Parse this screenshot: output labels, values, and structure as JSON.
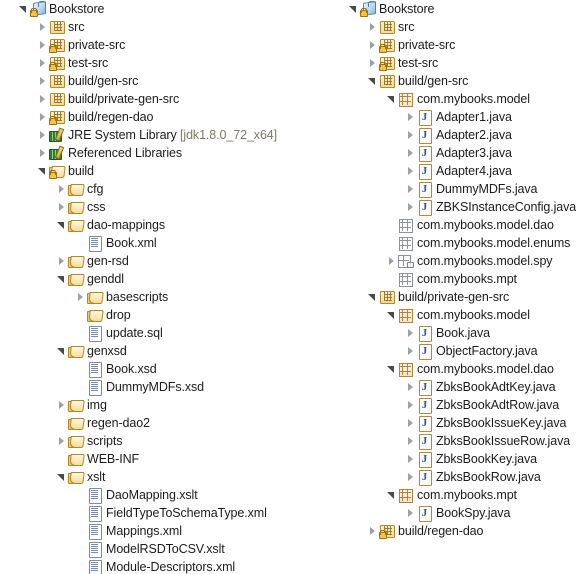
{
  "app": {
    "title": "Eclipse Project Explorer",
    "view_type": "tree",
    "colors": {
      "background": "#ffffff",
      "text": "#1c1c1c",
      "secondary_text": "#7d7a62",
      "twisty_collapsed": "#9aa2ab",
      "twisty_expanded": "#4a4a4a",
      "package_brown": "#b5813f",
      "package_grey": "#8e949b",
      "java_blue": "#2a56a8",
      "folder_gold": "#b3862c"
    }
  },
  "panels": [
    {
      "id": "left",
      "name": "project-tree-left",
      "rows": [
        {
          "indent": 0,
          "twisty": "expanded",
          "icon": "project-icon",
          "label": "Bookstore"
        },
        {
          "indent": 1,
          "twisty": "collapsed",
          "icon": "source-folder-icon",
          "label": "src"
        },
        {
          "indent": 1,
          "twisty": "collapsed",
          "icon": "source-folder-warning-icon",
          "label": "private-src"
        },
        {
          "indent": 1,
          "twisty": "collapsed",
          "icon": "source-folder-warning-icon",
          "label": "test-src"
        },
        {
          "indent": 1,
          "twisty": "collapsed",
          "icon": "source-folder-icon",
          "label": "build/gen-src"
        },
        {
          "indent": 1,
          "twisty": "collapsed",
          "icon": "source-folder-icon",
          "label": "build/private-gen-src"
        },
        {
          "indent": 1,
          "twisty": "collapsed",
          "icon": "source-folder-warning-icon",
          "label": "build/regen-dao"
        },
        {
          "indent": 1,
          "twisty": "collapsed",
          "icon": "library-icon",
          "label": "JRE System Library",
          "suffix": "[jdk1.8.0_72_x64]"
        },
        {
          "indent": 1,
          "twisty": "collapsed",
          "icon": "library-icon",
          "label": "Referenced Libraries"
        },
        {
          "indent": 1,
          "twisty": "expanded",
          "icon": "folder-warning-icon",
          "label": "build"
        },
        {
          "indent": 2,
          "twisty": "collapsed",
          "icon": "folder-icon",
          "label": "cfg"
        },
        {
          "indent": 2,
          "twisty": "collapsed",
          "icon": "folder-icon",
          "label": "css"
        },
        {
          "indent": 2,
          "twisty": "expanded",
          "icon": "folder-icon",
          "label": "dao-mappings"
        },
        {
          "indent": 3,
          "twisty": "none",
          "icon": "file-icon",
          "label": "Book.xml"
        },
        {
          "indent": 2,
          "twisty": "collapsed",
          "icon": "folder-icon",
          "label": "gen-rsd"
        },
        {
          "indent": 2,
          "twisty": "expanded",
          "icon": "folder-icon",
          "label": "genddl"
        },
        {
          "indent": 3,
          "twisty": "collapsed",
          "icon": "folder-icon",
          "label": "basescripts"
        },
        {
          "indent": 3,
          "twisty": "none",
          "icon": "folder-icon",
          "label": "drop"
        },
        {
          "indent": 3,
          "twisty": "none",
          "icon": "file-icon",
          "label": "update.sql"
        },
        {
          "indent": 2,
          "twisty": "expanded",
          "icon": "folder-icon",
          "label": "genxsd"
        },
        {
          "indent": 3,
          "twisty": "none",
          "icon": "file-icon",
          "label": "Book.xsd"
        },
        {
          "indent": 3,
          "twisty": "none",
          "icon": "file-icon",
          "label": "DummyMDFs.xsd"
        },
        {
          "indent": 2,
          "twisty": "collapsed",
          "icon": "folder-icon",
          "label": "img"
        },
        {
          "indent": 2,
          "twisty": "none",
          "icon": "folder-icon",
          "label": "regen-dao2"
        },
        {
          "indent": 2,
          "twisty": "collapsed",
          "icon": "folder-icon",
          "label": "scripts"
        },
        {
          "indent": 2,
          "twisty": "none",
          "icon": "folder-icon",
          "label": "WEB-INF"
        },
        {
          "indent": 2,
          "twisty": "expanded",
          "icon": "folder-icon",
          "label": "xslt"
        },
        {
          "indent": 3,
          "twisty": "none",
          "icon": "file-icon",
          "label": "DaoMapping.xslt"
        },
        {
          "indent": 3,
          "twisty": "none",
          "icon": "file-icon",
          "label": "FieldTypeToSchemaType.xml"
        },
        {
          "indent": 3,
          "twisty": "none",
          "icon": "file-icon",
          "label": "Mappings.xml"
        },
        {
          "indent": 3,
          "twisty": "none",
          "icon": "file-icon",
          "label": "ModelRSDToCSV.xslt"
        },
        {
          "indent": 3,
          "twisty": "none",
          "icon": "file-icon",
          "label": "Module-Descriptors.xml"
        }
      ]
    },
    {
      "id": "right",
      "name": "project-tree-right",
      "rows": [
        {
          "indent": 0,
          "twisty": "expanded",
          "icon": "project-icon",
          "label": "Bookstore"
        },
        {
          "indent": 1,
          "twisty": "collapsed",
          "icon": "source-folder-icon",
          "label": "src"
        },
        {
          "indent": 1,
          "twisty": "collapsed",
          "icon": "source-folder-warning-icon",
          "label": "private-src"
        },
        {
          "indent": 1,
          "twisty": "collapsed",
          "icon": "source-folder-warning-icon",
          "label": "test-src"
        },
        {
          "indent": 1,
          "twisty": "expanded",
          "icon": "source-folder-icon",
          "label": "build/gen-src"
        },
        {
          "indent": 2,
          "twisty": "expanded",
          "icon": "package-icon",
          "label": "com.mybooks.model"
        },
        {
          "indent": 3,
          "twisty": "collapsed",
          "icon": "java-file-icon",
          "label": "Adapter1.java"
        },
        {
          "indent": 3,
          "twisty": "collapsed",
          "icon": "java-file-icon",
          "label": "Adapter2.java"
        },
        {
          "indent": 3,
          "twisty": "collapsed",
          "icon": "java-file-icon",
          "label": "Adapter3.java"
        },
        {
          "indent": 3,
          "twisty": "collapsed",
          "icon": "java-file-icon",
          "label": "Adapter4.java"
        },
        {
          "indent": 3,
          "twisty": "collapsed",
          "icon": "java-file-icon",
          "label": "DummyMDFs.java"
        },
        {
          "indent": 3,
          "twisty": "collapsed",
          "icon": "java-file-icon",
          "label": "ZBKSInstanceConfig.java"
        },
        {
          "indent": 2,
          "twisty": "none",
          "icon": "package-empty-icon",
          "label": "com.mybooks.model.dao"
        },
        {
          "indent": 2,
          "twisty": "none",
          "icon": "package-empty-icon",
          "label": "com.mybooks.model.enums"
        },
        {
          "indent": 2,
          "twisty": "collapsed",
          "icon": "package-spy-icon",
          "label": "com.mybooks.model.spy"
        },
        {
          "indent": 2,
          "twisty": "none",
          "icon": "package-empty-icon",
          "label": "com.mybooks.mpt"
        },
        {
          "indent": 1,
          "twisty": "expanded",
          "icon": "source-folder-icon",
          "label": "build/private-gen-src"
        },
        {
          "indent": 2,
          "twisty": "expanded",
          "icon": "package-icon",
          "label": "com.mybooks.model"
        },
        {
          "indent": 3,
          "twisty": "collapsed",
          "icon": "java-file-icon",
          "label": "Book.java"
        },
        {
          "indent": 3,
          "twisty": "collapsed",
          "icon": "java-file-icon",
          "label": "ObjectFactory.java"
        },
        {
          "indent": 2,
          "twisty": "expanded",
          "icon": "package-icon",
          "label": "com.mybooks.model.dao"
        },
        {
          "indent": 3,
          "twisty": "collapsed",
          "icon": "java-file-icon",
          "label": "ZbksBookAdtKey.java"
        },
        {
          "indent": 3,
          "twisty": "collapsed",
          "icon": "java-file-icon",
          "label": "ZbksBookAdtRow.java"
        },
        {
          "indent": 3,
          "twisty": "collapsed",
          "icon": "java-file-icon",
          "label": "ZbksBookIssueKey.java"
        },
        {
          "indent": 3,
          "twisty": "collapsed",
          "icon": "java-file-icon",
          "label": "ZbksBookIssueRow.java"
        },
        {
          "indent": 3,
          "twisty": "collapsed",
          "icon": "java-file-icon",
          "label": "ZbksBookKey.java"
        },
        {
          "indent": 3,
          "twisty": "collapsed",
          "icon": "java-file-icon",
          "label": "ZbksBookRow.java"
        },
        {
          "indent": 2,
          "twisty": "expanded",
          "icon": "package-icon",
          "label": "com.mybooks.mpt"
        },
        {
          "indent": 3,
          "twisty": "collapsed",
          "icon": "java-file-icon",
          "label": "BookSpy.java"
        },
        {
          "indent": 1,
          "twisty": "collapsed",
          "icon": "source-folder-warning-icon",
          "label": "build/regen-dao"
        }
      ]
    }
  ]
}
